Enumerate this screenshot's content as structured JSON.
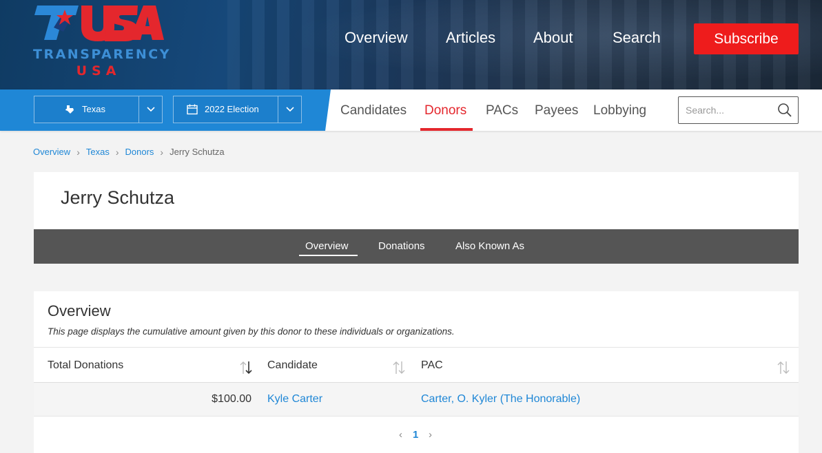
{
  "header": {
    "logo_top": "TRANSPARENCY",
    "logo_bottom": "USA",
    "nav": [
      "Overview",
      "Articles",
      "About",
      "Search"
    ],
    "subscribe_label": "Subscribe"
  },
  "subbar": {
    "state_label": "Texas",
    "election_label": "2022 Election",
    "nav": [
      "Candidates",
      "Donors",
      "PACs",
      "Payees",
      "Lobbying"
    ],
    "active_nav": "Donors",
    "search_placeholder": "Search..."
  },
  "breadcrumb": {
    "items": [
      "Overview",
      "Texas",
      "Donors"
    ],
    "current": "Jerry Schutza"
  },
  "page": {
    "title": "Jerry Schutza",
    "tabs": [
      "Overview",
      "Donations",
      "Also Known As"
    ],
    "active_tab": "Overview"
  },
  "overview": {
    "heading": "Overview",
    "description": "This page displays the cumulative amount given by this donor to these individuals or organizations.",
    "columns": [
      "Total Donations",
      "Candidate",
      "PAC"
    ],
    "rows": [
      {
        "total": "$100.00",
        "candidate": "Kyle Carter",
        "pac": "Carter, O. Kyler (The Honorable)"
      }
    ],
    "pagination": {
      "prev": "‹",
      "current": "1",
      "next": "›"
    }
  },
  "colors": {
    "brand_red": "#e4272d",
    "brand_blue": "#1f87d6",
    "tab_bar": "#555555"
  }
}
